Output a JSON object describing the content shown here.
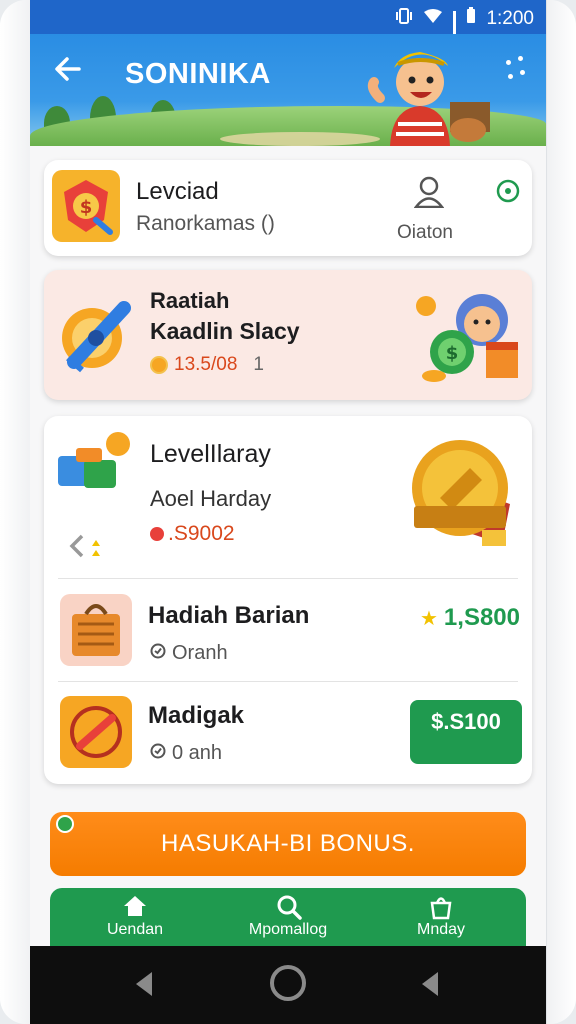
{
  "status_bar": {
    "time": "1:200"
  },
  "header": {
    "title": "SONINIKA"
  },
  "card_top": {
    "title": "Levciad",
    "subtitle": "Ranorkamas ()",
    "account_label": "Oiaton"
  },
  "card_reward": {
    "title_line1": "Raatiah",
    "title_line2": "Kaadlin Slacy",
    "amount": "13.5/08",
    "amount_suffix": "1"
  },
  "card_list": {
    "level": {
      "title": "LevelIlaray",
      "subtitle": "Aoel Harday",
      "amount": ".S9002"
    },
    "items": [
      {
        "title": "Hadiah Barian",
        "meta": "Oranh",
        "value": "1,S800"
      },
      {
        "title": "Madigak",
        "meta": "0 anh",
        "button": "$.S100"
      }
    ]
  },
  "promo": {
    "label": "HASUKAH-BI BONUS."
  },
  "bottom_nav": [
    {
      "label": "Uendan",
      "icon": "home-icon"
    },
    {
      "label": "Mpomallog",
      "icon": "search-icon"
    },
    {
      "label": "Mnday",
      "icon": "bag-icon"
    }
  ],
  "colors": {
    "header_blue": "#2a8de3",
    "accent_green": "#1f9a4f",
    "promo_orange": "#f57c00",
    "amount_red": "#d9481c"
  }
}
